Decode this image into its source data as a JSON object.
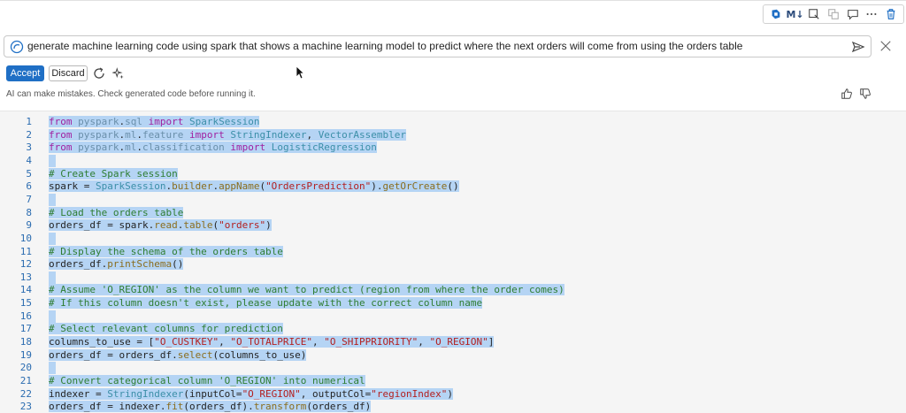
{
  "toolbar": {
    "markdown_label": "M↓",
    "icons": [
      "copilot-icon",
      "markdown-toggle",
      "select-icon",
      "copy-icon",
      "comment-icon",
      "more-icon",
      "delete-icon"
    ]
  },
  "prompt": {
    "text": "generate machine learning code using spark that shows a machine learning model to predict where the next orders will come from using the orders table"
  },
  "actions": {
    "accept_label": "Accept",
    "discard_label": "Discard"
  },
  "disclaimer": "AI can make mistakes. Check generated code before running it.",
  "colors": {
    "accent": "#1f6fc5",
    "selection": "#b5d4f4",
    "line_numbers": "#2b6cb0"
  },
  "code": {
    "lines": [
      {
        "n": "1",
        "t": "from pyspark.sql import SparkSession"
      },
      {
        "n": "2",
        "t": "from pyspark.ml.feature import StringIndexer, VectorAssembler"
      },
      {
        "n": "3",
        "t": "from pyspark.ml.classification import LogisticRegression"
      },
      {
        "n": "4",
        "t": ""
      },
      {
        "n": "5",
        "t": "# Create Spark session"
      },
      {
        "n": "6",
        "t": "spark = SparkSession.builder.appName(\"OrdersPrediction\").getOrCreate()"
      },
      {
        "n": "7",
        "t": ""
      },
      {
        "n": "8",
        "t": "# Load the orders table"
      },
      {
        "n": "9",
        "t": "orders_df = spark.read.table(\"orders\")"
      },
      {
        "n": "10",
        "t": ""
      },
      {
        "n": "11",
        "t": "# Display the schema of the orders table"
      },
      {
        "n": "12",
        "t": "orders_df.printSchema()"
      },
      {
        "n": "13",
        "t": ""
      },
      {
        "n": "14",
        "t": "# Assume 'O_REGION' as the column we want to predict (region from where the order comes)"
      },
      {
        "n": "15",
        "t": "# If this column doesn't exist, please update with the correct column name"
      },
      {
        "n": "16",
        "t": ""
      },
      {
        "n": "17",
        "t": "# Select relevant columns for prediction"
      },
      {
        "n": "18",
        "t": "columns_to_use = [\"O_CUSTKEY\", \"O_TOTALPRICE\", \"O_SHIPPRIORITY\", \"O_REGION\"]"
      },
      {
        "n": "19",
        "t": "orders_df = orders_df.select(columns_to_use)"
      },
      {
        "n": "20",
        "t": ""
      },
      {
        "n": "21",
        "t": "# Convert categorical column 'O_REGION' into numerical"
      },
      {
        "n": "22",
        "t": "indexer = StringIndexer(inputCol=\"O_REGION\", outputCol=\"regionIndex\")"
      },
      {
        "n": "23",
        "t": "orders_df = indexer.fit(orders_df).transform(orders_df)"
      }
    ]
  }
}
